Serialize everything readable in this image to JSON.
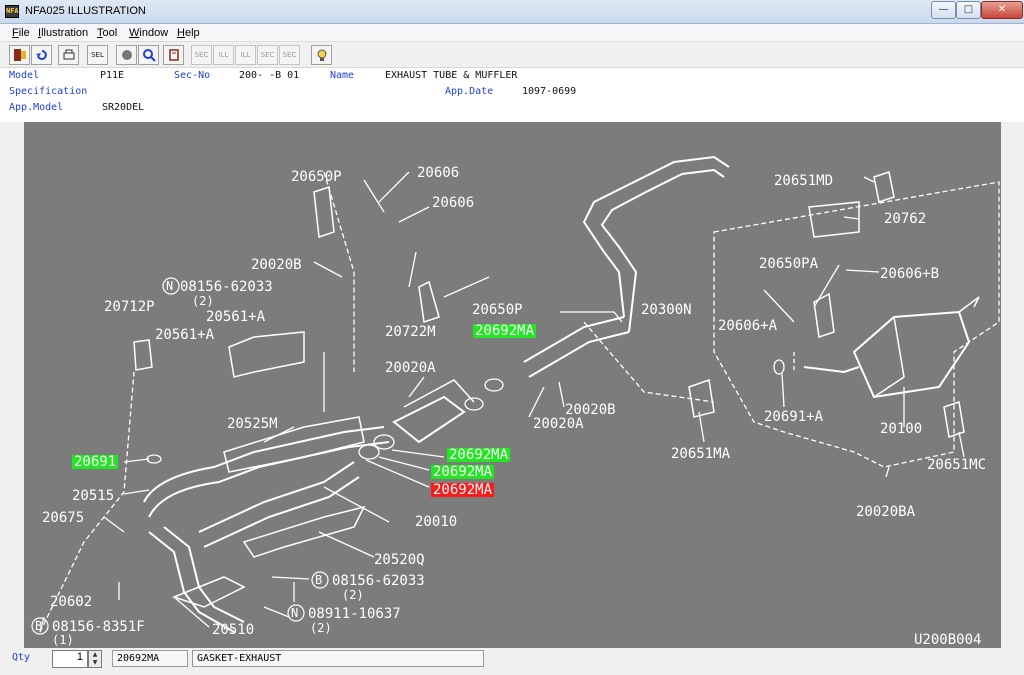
{
  "window": {
    "title": "NFA025 ILLUSTRATION",
    "icon_label": "NFA",
    "controls": {
      "minimize": "—",
      "maximize": "□",
      "close": "✕"
    }
  },
  "menu": {
    "items": [
      "File",
      "Illustration",
      "Tool",
      "Window",
      "Help"
    ]
  },
  "toolbar": {
    "buttons": [
      {
        "name": "exit-icon",
        "label": ""
      },
      {
        "name": "back-icon",
        "label": ""
      },
      {
        "name": "print-icon",
        "label": ""
      },
      {
        "name": "select-icon",
        "label": "SEL"
      },
      {
        "name": "record-icon",
        "label": ""
      },
      {
        "name": "magnify-icon",
        "label": ""
      },
      {
        "name": "book-icon",
        "label": ""
      },
      {
        "name": "sec-prev-icon",
        "label": "SEC"
      },
      {
        "name": "ill-prev-icon",
        "label": "ILL"
      },
      {
        "name": "ill-next-icon",
        "label": "ILL"
      },
      {
        "name": "sec-next-icon",
        "label": "SEC"
      },
      {
        "name": "sec-query-icon",
        "label": "SEC"
      },
      {
        "name": "hint-icon",
        "label": ""
      }
    ]
  },
  "info": {
    "model_label": "Model",
    "model_value": "P11E",
    "secno_label": "Sec-No",
    "secno_value": "200-  -B 01",
    "name_label": "Name",
    "name_value": "EXHAUST TUBE & MUFFLER",
    "spec_label": "Specification",
    "appdate_label": "App.Date",
    "appdate_value": "1097-0699",
    "appmodel_label": "App.Model",
    "appmodel_value": "SR20DEL"
  },
  "illustration": {
    "code": "U200B004",
    "parts": [
      "20650P",
      "20606",
      "20606",
      "20020B",
      "08156-62033",
      "(2)",
      "20712P",
      "20561+A",
      "20561+A",
      "20722M",
      "20650P",
      "20692MA",
      "20300N",
      "20020A",
      "20020B",
      "20020A",
      "20525M",
      "20692MA",
      "20692MA",
      "20692MA",
      "20691",
      "20515",
      "20675",
      "20010",
      "20520Q",
      "08156-62033",
      "(2)",
      "08911-10637",
      "(2)",
      "20602",
      "20510",
      "08156-8351F",
      "(1)",
      "20651MD",
      "20762",
      "20650PA",
      "20606+B",
      "20606+A",
      "20691+A",
      "20651MA",
      "20100",
      "20651MC",
      "20020BA"
    ],
    "circle_markers": [
      "N",
      "B",
      "N",
      "B"
    ],
    "colors": {
      "background": "#7c7c7c",
      "lines": "#ffffff",
      "highlight": "#22e622",
      "selected": "#ff1a1a"
    }
  },
  "status": {
    "qty_label": "Qty",
    "qty_value": "1",
    "part_no": "20692MA",
    "part_name": "GASKET-EXHAUST"
  }
}
